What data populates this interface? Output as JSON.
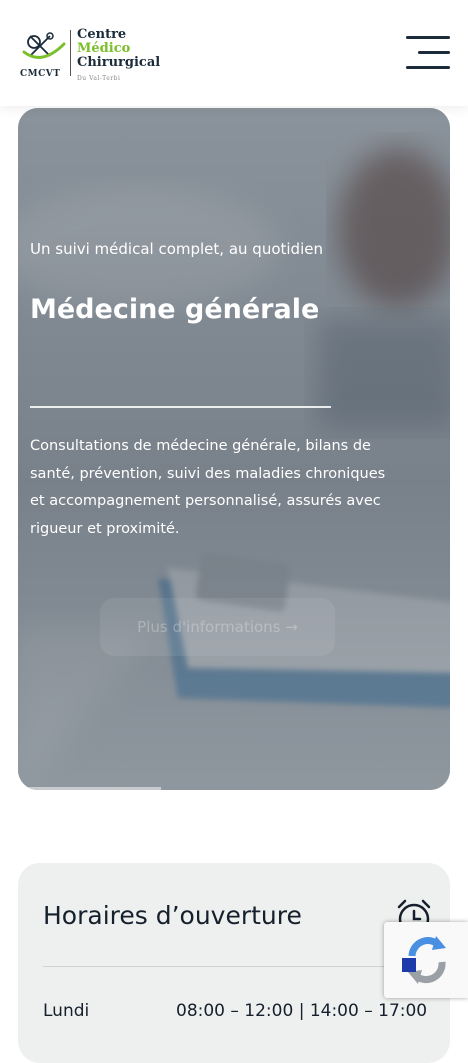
{
  "header": {
    "logo": {
      "line1": "Centre",
      "line2": "Médico",
      "line3": "Chirurgical",
      "subline": "Du Val-Terbi",
      "initials": "CMCVT"
    }
  },
  "hero": {
    "eyebrow": "Un suivi médical complet, au quotidien",
    "title": "Médecine générale",
    "description": "Consultations de médecine générale, bilans de santé, prévention, suivi des maladies chroniques et accompagnement personnalisé, assurés avec rigueur et proximité.",
    "cta_label": "Plus d'informations →",
    "slide_progress": 0.33
  },
  "hours": {
    "title": "Horaires d’ouverture",
    "rows": [
      {
        "day": "Lundi",
        "time": "08:00 – 12:00 | 14:00 – 17:00"
      }
    ]
  },
  "colors": {
    "brand_dark": "#1c2b3a",
    "brand_green": "#7bbf2a",
    "card_bg": "#eef0ef"
  },
  "icons": {
    "menu": "hamburger-menu-icon",
    "clock": "alarm-clock-icon",
    "recaptcha": "recaptcha-icon"
  }
}
